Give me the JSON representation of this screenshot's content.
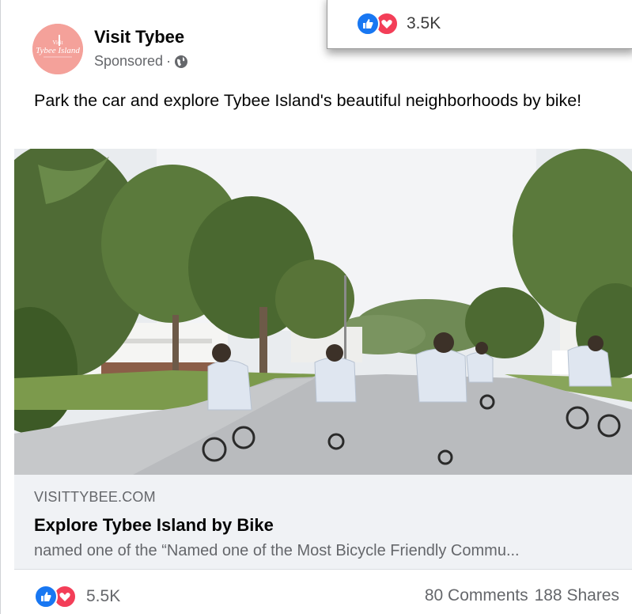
{
  "overlay": {
    "reaction_count": "3.5K",
    "reactions": [
      "like-icon",
      "love-icon"
    ]
  },
  "post": {
    "page_name": "Visit Tybee",
    "sponsored_label": "Sponsored",
    "meta_separator": "·",
    "audience_icon": "globe-icon",
    "more_icon": "more-options-icon",
    "avatar_text": "Tybee Island",
    "text": "Park the car and explore Tybee Island's beautiful neighborhoods by bike!"
  },
  "link_preview": {
    "domain": "VISITTYBEE.COM",
    "title": "Explore Tybee Island by Bike",
    "description": "named one of the “Named one of the Most Bicycle Friendly Commu..."
  },
  "footer": {
    "reaction_count": "5.5K",
    "comments": "80 Comments",
    "shares": "188 Shares"
  },
  "colors": {
    "like_blue": "#1877f2",
    "love_red": "#f33e58",
    "avatar_pink": "#f4a19a",
    "secondary_text": "#65676b",
    "link_bg": "#f0f2f5"
  }
}
